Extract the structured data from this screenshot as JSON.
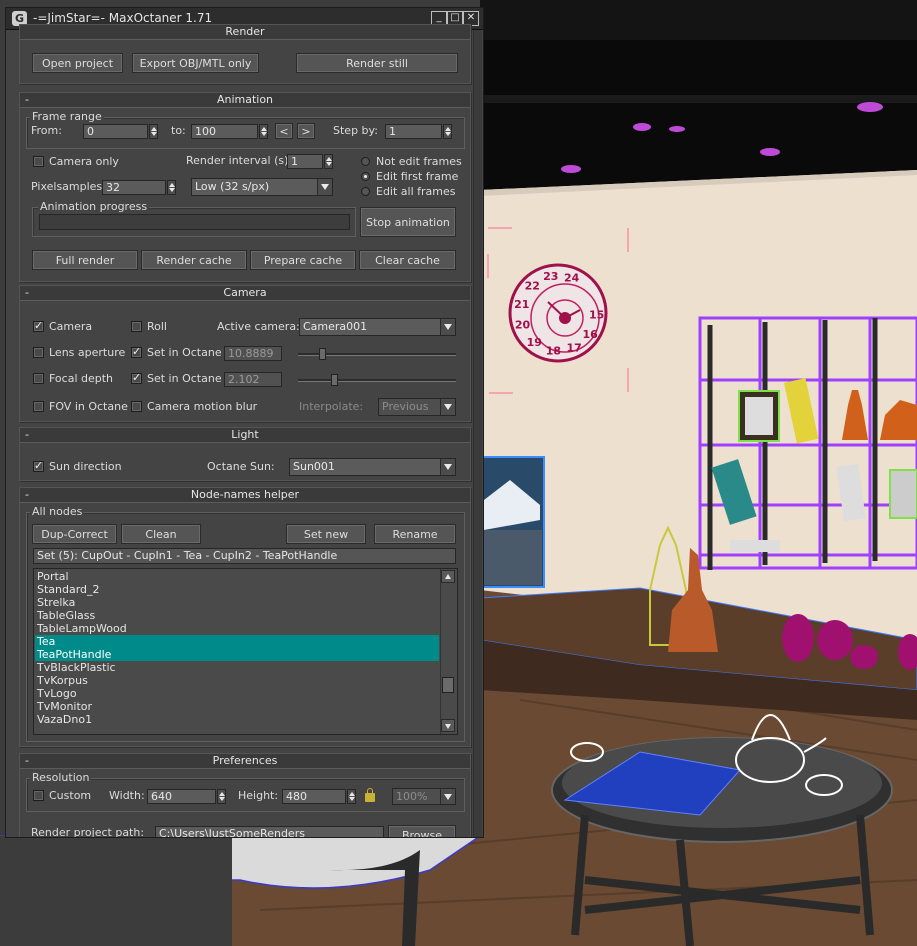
{
  "window": {
    "icon_glyph": "G",
    "title": "-=JimStar=- MaxOctaner 1.71",
    "min_glyph": "_",
    "max_glyph": "□",
    "close_glyph": "✕"
  },
  "render": {
    "title": "Render",
    "open_project": "Open project",
    "export_obj": "Export OBJ/MTL only",
    "render_still": "Render still"
  },
  "animation": {
    "title": "Animation",
    "collapse": "-",
    "frame_range": "Frame range",
    "from_label": "From:",
    "from_value": "0",
    "to_label": "to:",
    "to_value": "100",
    "prev": "<",
    "next": ">",
    "step_label": "Step by:",
    "step_value": "1",
    "camera_only": "Camera only",
    "camera_only_checked": false,
    "render_interval_label": "Render interval (s):",
    "render_interval_value": "1",
    "radio_not_edit": "Not edit frames",
    "radio_edit_first": "Edit first frame",
    "radio_edit_all": "Edit all frames",
    "selected_radio": "edit_first",
    "pixelsamples_label": "Pixelsamples:",
    "pixelsamples_value": "32",
    "quality_value": "Low (32 s/px)",
    "progress_label": "Animation progress",
    "progress_fraction": 0,
    "stop_animation": "Stop animation",
    "full_render": "Full render",
    "render_cache": "Render cache",
    "prepare_cache": "Prepare cache",
    "clear_cache": "Clear cache"
  },
  "camera": {
    "title": "Camera",
    "collapse": "-",
    "camera_cb": "Camera",
    "camera_checked": true,
    "roll_cb": "Roll",
    "roll_checked": false,
    "active_camera_label": "Active camera:",
    "active_camera_value": "Camera001",
    "lens_aperture": "Lens aperture",
    "set_in_octane_1": "Set in Octane",
    "aperture_value": "10.8889",
    "aperture_slider": 0.14,
    "focal_depth": "Focal depth",
    "set_in_octane_2": "Set in Octane",
    "focal_value": "2.102",
    "focal_slider": 0.22,
    "fov_in_octane": "FOV in Octane",
    "motion_blur": "Camera motion blur",
    "interpolate_label": "Interpolate:",
    "interpolate_value": "Previous"
  },
  "light": {
    "title": "Light",
    "collapse": "-",
    "sun_direction": "Sun direction",
    "sun_checked": true,
    "octane_sun_label": "Octane Sun:",
    "octane_sun_value": "Sun001"
  },
  "nodes": {
    "title": "Node-names helper",
    "collapse": "-",
    "all_nodes": "All nodes",
    "dup_correct": "Dup-Correct",
    "clean": "Clean",
    "set_new": "Set new",
    "rename": "Rename",
    "set_value": "Set (5): CupOut - CupIn1 - Tea - CupIn2 - TeaPotHandle",
    "items": [
      {
        "label": "Portal",
        "selected": false
      },
      {
        "label": "Standard_2",
        "selected": false
      },
      {
        "label": "Strelka",
        "selected": false
      },
      {
        "label": "TableGlass",
        "selected": false
      },
      {
        "label": "TableLampWood",
        "selected": false
      },
      {
        "label": "Tea",
        "selected": true
      },
      {
        "label": "TeaPotHandle",
        "selected": true
      },
      {
        "label": "TvBlackPlastic",
        "selected": false
      },
      {
        "label": "TvKorpus",
        "selected": false
      },
      {
        "label": "TvLogo",
        "selected": false
      },
      {
        "label": "TvMonitor",
        "selected": false
      },
      {
        "label": "VazaDno1",
        "selected": false
      }
    ]
  },
  "preferences": {
    "title": "Preferences",
    "collapse": "-",
    "resolution": "Resolution",
    "custom": "Custom",
    "custom_checked": false,
    "width_label": "Width:",
    "width_value": "640",
    "height_label": "Height:",
    "height_value": "480",
    "percent_value": "100%",
    "render_path_label": "Render project path:",
    "render_path_value": "C:\\Users\\JustSomeRenders",
    "browse": "Browse"
  },
  "scene": {
    "clock_numbers": [
      "24",
      "23",
      "22",
      "21",
      "20",
      "19",
      "18",
      "17",
      "16",
      "15"
    ]
  },
  "colors": {
    "selection": "#008b8b",
    "panel": "#444444",
    "wall": "#ede0cf",
    "floor": "#6a4a33",
    "wire_purple": "#a040ff",
    "magenta": "#a0106e"
  }
}
